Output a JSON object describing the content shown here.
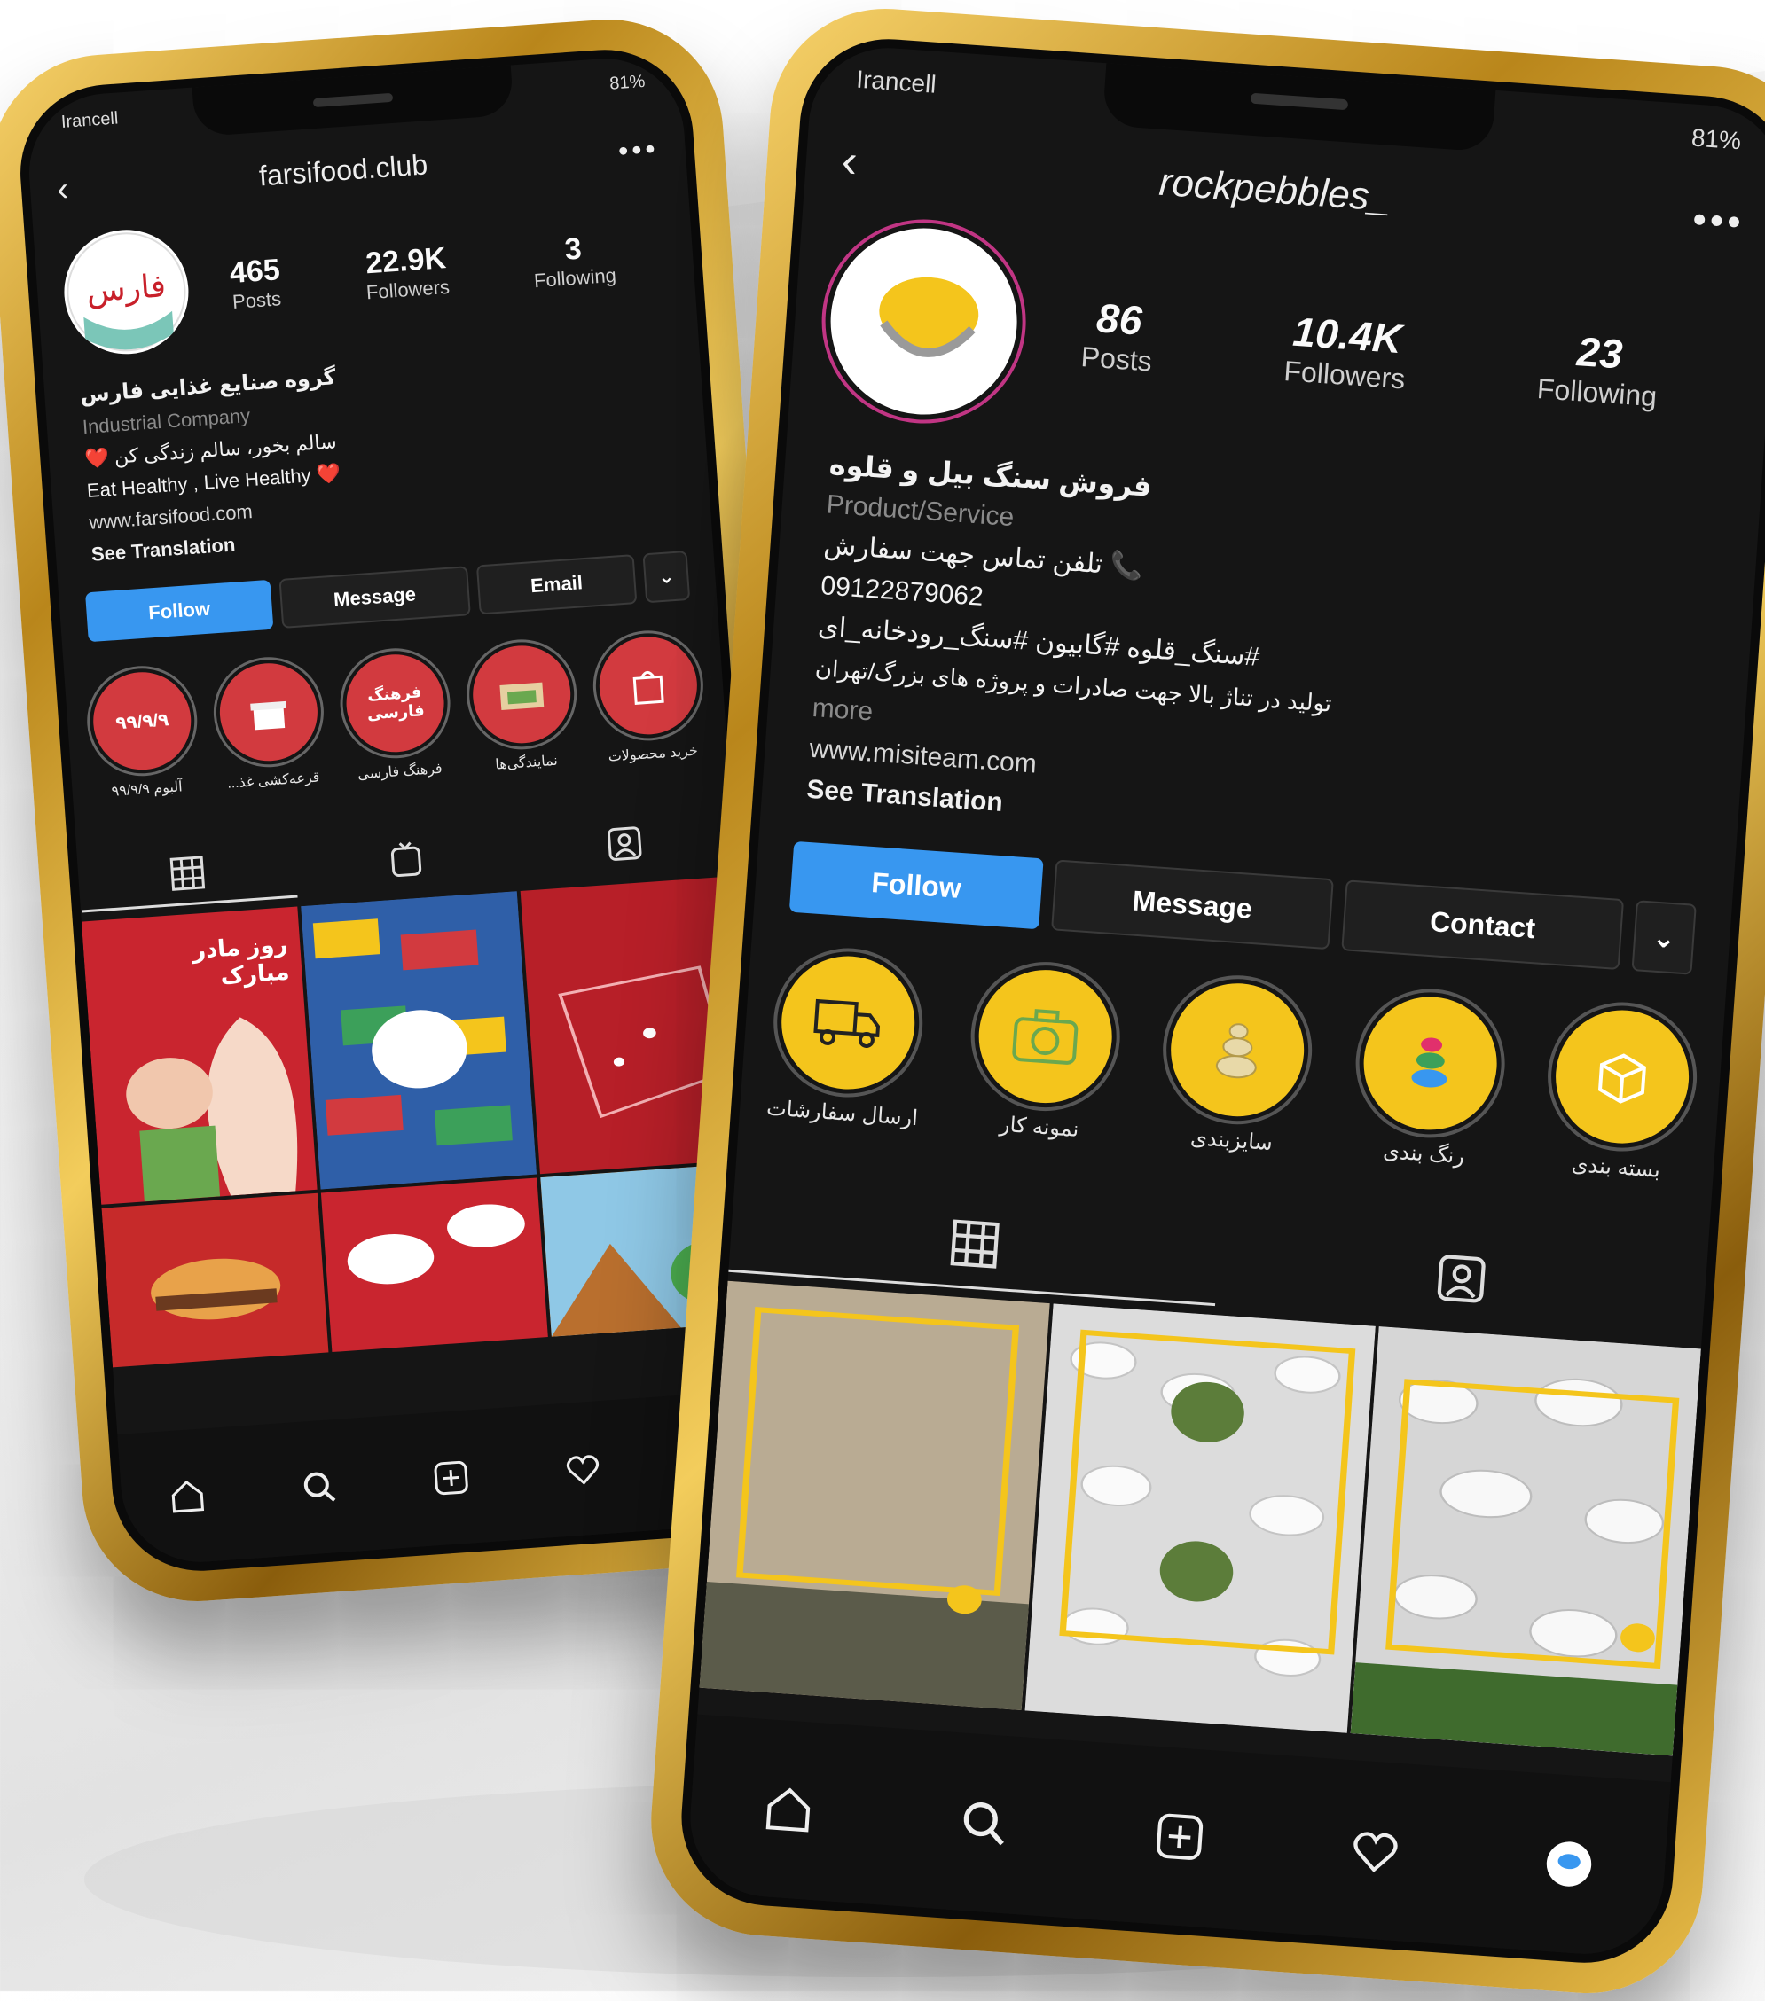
{
  "left": {
    "status": {
      "carrier": "Irancell",
      "battery": "81%"
    },
    "username": "farsifood.club",
    "stats": [
      {
        "value": "465",
        "label": "Posts"
      },
      {
        "value": "22.9K",
        "label": "Followers"
      },
      {
        "value": "3",
        "label": "Following"
      }
    ],
    "bio": {
      "name": "گروه صنایع غذایی فارس",
      "category": "Industrial Company",
      "line1": "سالم بخور، سالم زندگی کن ❤️",
      "line2": "Eat Healthy , Live Healthy ❤️",
      "link": "www.farsifood.com",
      "translation": "See Translation"
    },
    "buttons": {
      "follow": "Follow",
      "message": "Message",
      "email": "Email",
      "more": "⌄"
    },
    "highlights": [
      {
        "label": "آلبوم ۹۹/۹/۹",
        "inner": "۹۹/۹/۹"
      },
      {
        "label": "قرعه‌کشی غذ...",
        "inner": ""
      },
      {
        "label": "فرهنگ فارسی",
        "inner": "فرهنگ فارسی"
      },
      {
        "label": "نمایندگی‌ها",
        "inner": ""
      },
      {
        "label": "خرید محصولات",
        "inner": ""
      }
    ],
    "posts": [
      {
        "text": "روز مادر مبارک",
        "bg": "#c9252f"
      },
      {
        "text": "",
        "bg": "#3b6fb6"
      },
      {
        "text": "",
        "bg": "#b71f28"
      },
      {
        "text": "",
        "bg": "#c62a2a"
      },
      {
        "text": "",
        "bg": "#c9252f"
      },
      {
        "text": "",
        "bg": "#cf8f48"
      }
    ],
    "colors": {
      "accent": "#3897f0",
      "highlight": "#d23a3f"
    }
  },
  "right": {
    "status": {
      "carrier": "Irancell",
      "battery": "81%"
    },
    "username": "rockpebbles_",
    "stats": [
      {
        "value": "86",
        "label": "Posts"
      },
      {
        "value": "10.4K",
        "label": "Followers"
      },
      {
        "value": "23",
        "label": "Following"
      }
    ],
    "bio": {
      "name": "فروش سنگ بیل و قلوه",
      "category": "Product/Service",
      "line1": "📞 تلفن تماس جهت سفارش",
      "phone": "09122879062",
      "hashtags": "#سنگ_قلوه #گابیون #سنگ_رودخانه_ای",
      "line2": "تولید در تناژ بالا جهت صادرات و پروژه های بزرگ/تهران",
      "more": "more",
      "link": "www.misiteam.com",
      "translation": "See Translation"
    },
    "buttons": {
      "follow": "Follow",
      "message": "Message",
      "contact": "Contact",
      "more": "⌄"
    },
    "highlights": [
      {
        "label": "ارسال سفارشات",
        "icon": "truck-icon"
      },
      {
        "label": "نمونه کار",
        "icon": "camera-icon"
      },
      {
        "label": "سایزبندی",
        "icon": "stones-icon"
      },
      {
        "label": "رنگ بندی",
        "icon": "colors-icon"
      },
      {
        "label": "بسته بندی",
        "icon": "box-icon"
      }
    ],
    "colors": {
      "accent": "#3897f0",
      "highlight": "#f4c51c"
    }
  }
}
